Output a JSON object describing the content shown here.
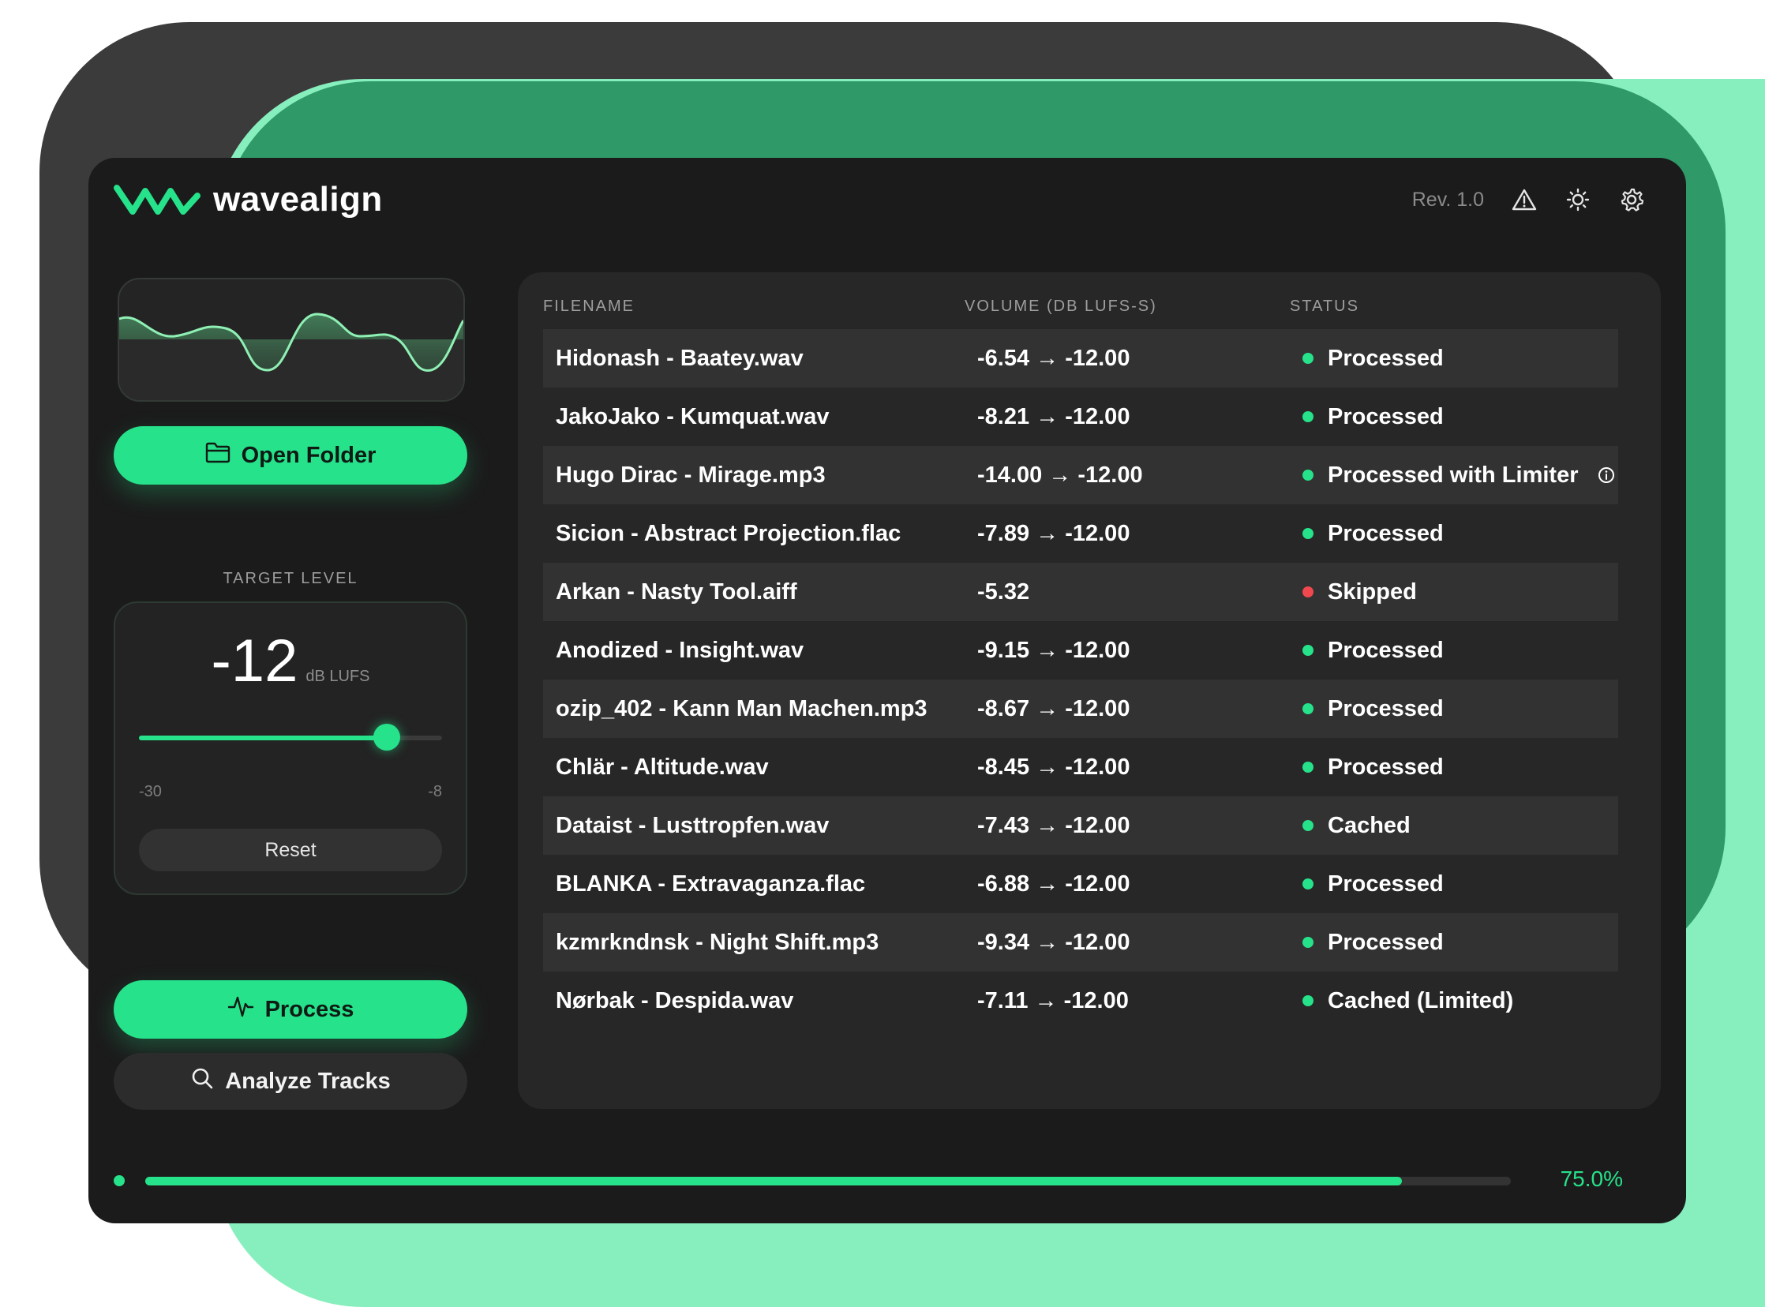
{
  "app": {
    "name": "wavealign",
    "revision": "Rev. 1.0"
  },
  "icons": {
    "logo": "wave-logo-icon",
    "warning": "warning-triangle-icon",
    "theme": "sun-icon",
    "settings": "gear-icon",
    "folder": "folder-icon",
    "process": "pulse-icon",
    "analyze": "search-icon",
    "info": "info-circle-icon"
  },
  "colors": {
    "accent": "#26e28a",
    "skipped": "#f0484e",
    "window_bg": "#1b1b1b"
  },
  "sidebar": {
    "open_folder_label": "Open Folder",
    "target": {
      "label": "TARGET LEVEL",
      "value": "-12",
      "unit": "dB LUFS",
      "min_label": "-30",
      "max_label": "-8",
      "min": -30,
      "max": -8,
      "current": -12,
      "reset_label": "Reset"
    },
    "process_label": "Process",
    "analyze_label": "Analyze Tracks"
  },
  "table": {
    "headers": {
      "filename": "FILENAME",
      "volume": "VOLUME (DB LUFS-S)",
      "status": "STATUS"
    },
    "rows": [
      {
        "filename": "Hidonash - Baatey.wav",
        "volume": "-6.54 → -12.00",
        "status": "Processed",
        "state": "ok"
      },
      {
        "filename": "JakoJako - Kumquat.wav",
        "volume": "-8.21 → -12.00",
        "status": "Processed",
        "state": "ok"
      },
      {
        "filename": "Hugo Dirac - Mirage.mp3",
        "volume": "-14.00 → -12.00",
        "status": "Processed with Limiter",
        "state": "ok",
        "info": true
      },
      {
        "filename": "Sicion - Abstract Projection.flac",
        "volume": "-7.89 → -12.00",
        "status": "Processed",
        "state": "ok"
      },
      {
        "filename": "Arkan - Nasty Tool.aiff",
        "volume": "-5.32",
        "status": "Skipped",
        "state": "skipped"
      },
      {
        "filename": "Anodized - Insight.wav",
        "volume": "-9.15 → -12.00",
        "status": "Processed",
        "state": "ok"
      },
      {
        "filename": "ozip_402 - Kann Man Machen.mp3",
        "volume": "-8.67 → -12.00",
        "status": "Processed",
        "state": "ok"
      },
      {
        "filename": "Chlär - Altitude.wav",
        "volume": "-8.45 → -12.00",
        "status": "Processed",
        "state": "ok"
      },
      {
        "filename": "Dataist - Lusttropfen.wav",
        "volume": "-7.43 → -12.00",
        "status": "Cached",
        "state": "ok"
      },
      {
        "filename": "BLANKA - Extravaganza.flac",
        "volume": "-6.88 → -12.00",
        "status": "Processed",
        "state": "ok"
      },
      {
        "filename": "kzmrkndnsk - Night Shift.mp3",
        "volume": "-9.34 → -12.00",
        "status": "Processed",
        "state": "ok"
      },
      {
        "filename": "Nørbak - Despida.wav",
        "volume": "-7.11 → -12.00",
        "status": "Cached (Limited)",
        "state": "ok"
      }
    ]
  },
  "progress": {
    "percent_label": "75.0%",
    "fraction": 0.92
  }
}
